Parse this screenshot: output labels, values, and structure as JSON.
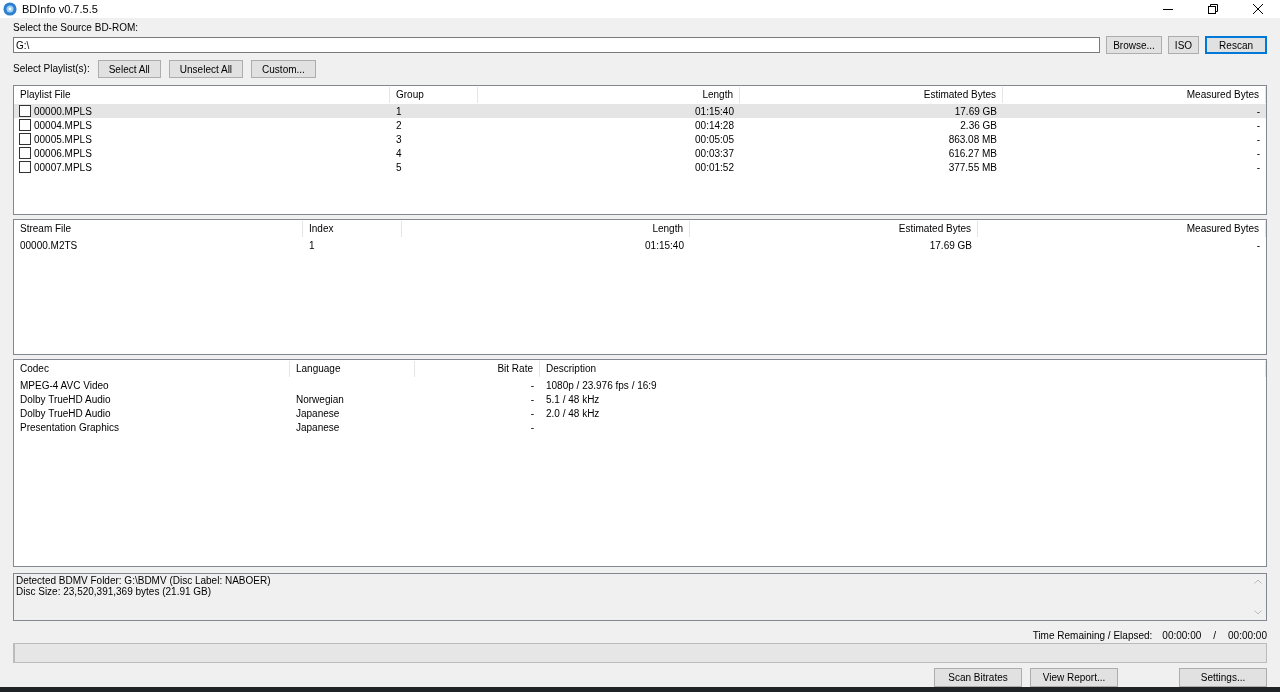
{
  "window": {
    "title": "BDInfo v0.7.5.5"
  },
  "source": {
    "label": "Select the Source BD-ROM:",
    "value": "G:\\",
    "buttons": [
      {
        "label": "Browse...",
        "focused": false
      },
      {
        "label": "ISO",
        "focused": false
      },
      {
        "label": "Rescan",
        "focused": true
      }
    ]
  },
  "playlist_bar": {
    "label": "Select Playlist(s):",
    "buttons": [
      "Select All",
      "Unselect All",
      "Custom..."
    ]
  },
  "playlists": {
    "columns": [
      "Playlist File",
      "Group",
      "Length",
      "Estimated Bytes",
      "Measured Bytes"
    ],
    "rows": [
      {
        "file": "00000.MPLS",
        "group": "1",
        "length": "01:15:40",
        "estimated": "17.69 GB",
        "measured": "-",
        "checked": false,
        "selected": true
      },
      {
        "file": "00004.MPLS",
        "group": "2",
        "length": "00:14:28",
        "estimated": "2.36 GB",
        "measured": "-",
        "checked": false,
        "selected": false
      },
      {
        "file": "00005.MPLS",
        "group": "3",
        "length": "00:05:05",
        "estimated": "863.08 MB",
        "measured": "-",
        "checked": false,
        "selected": false
      },
      {
        "file": "00006.MPLS",
        "group": "4",
        "length": "00:03:37",
        "estimated": "616.27 MB",
        "measured": "-",
        "checked": false,
        "selected": false
      },
      {
        "file": "00007.MPLS",
        "group": "5",
        "length": "00:01:52",
        "estimated": "377.55 MB",
        "measured": "-",
        "checked": false,
        "selected": false
      }
    ]
  },
  "streams": {
    "columns": [
      "Stream File",
      "Index",
      "Length",
      "Estimated Bytes",
      "Measured Bytes"
    ],
    "rows": [
      {
        "file": "00000.M2TS",
        "index": "1",
        "length": "01:15:40",
        "estimated": "17.69 GB",
        "measured": "-"
      }
    ]
  },
  "codecs": {
    "columns": [
      "Codec",
      "Language",
      "Bit Rate",
      "Description"
    ],
    "rows": [
      {
        "codec": "MPEG-4 AVC Video",
        "language": "",
        "bitrate": "-",
        "description": "1080p / 23.976 fps / 16:9"
      },
      {
        "codec": "Dolby TrueHD Audio",
        "language": "Norwegian",
        "bitrate": "-",
        "description": "5.1 / 48 kHz"
      },
      {
        "codec": "Dolby TrueHD Audio",
        "language": "Japanese",
        "bitrate": "-",
        "description": "2.0 / 48 kHz"
      },
      {
        "codec": "Presentation Graphics",
        "language": "Japanese",
        "bitrate": "-",
        "description": ""
      }
    ]
  },
  "log": [
    "Detected BDMV Folder: G:\\BDMV (Disc Label: NABOER)",
    "Disc Size: 23,520,391,369 bytes (21.91 GB)"
  ],
  "time": {
    "label": "Time Remaining / Elapsed:",
    "remaining": "00:00:00",
    "separator": "/",
    "elapsed": "00:00:00"
  },
  "progress": {
    "level": 0
  },
  "bottom_buttons": [
    "Scan Bitrates",
    "View Report...",
    "Settings..."
  ]
}
